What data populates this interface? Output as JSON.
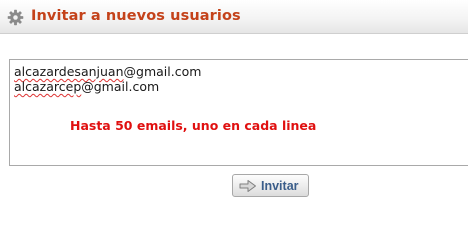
{
  "header": {
    "title": "Invitar a nuevos usuarios",
    "icon": "gear-icon"
  },
  "emails": {
    "lines": [
      {
        "user": "alcazardesanjuan",
        "domain": "@gmail.com"
      },
      {
        "user": "alcazarcep",
        "domain": "@gmail.com"
      }
    ],
    "hint": "Hasta 50 emails, uno en cada linea"
  },
  "actions": {
    "invite_label": "Invitar",
    "invite_icon": "arrow-right-icon"
  },
  "colors": {
    "title": "#c4421a",
    "hint": "#e01010",
    "button_text": "#3a5d8a"
  }
}
